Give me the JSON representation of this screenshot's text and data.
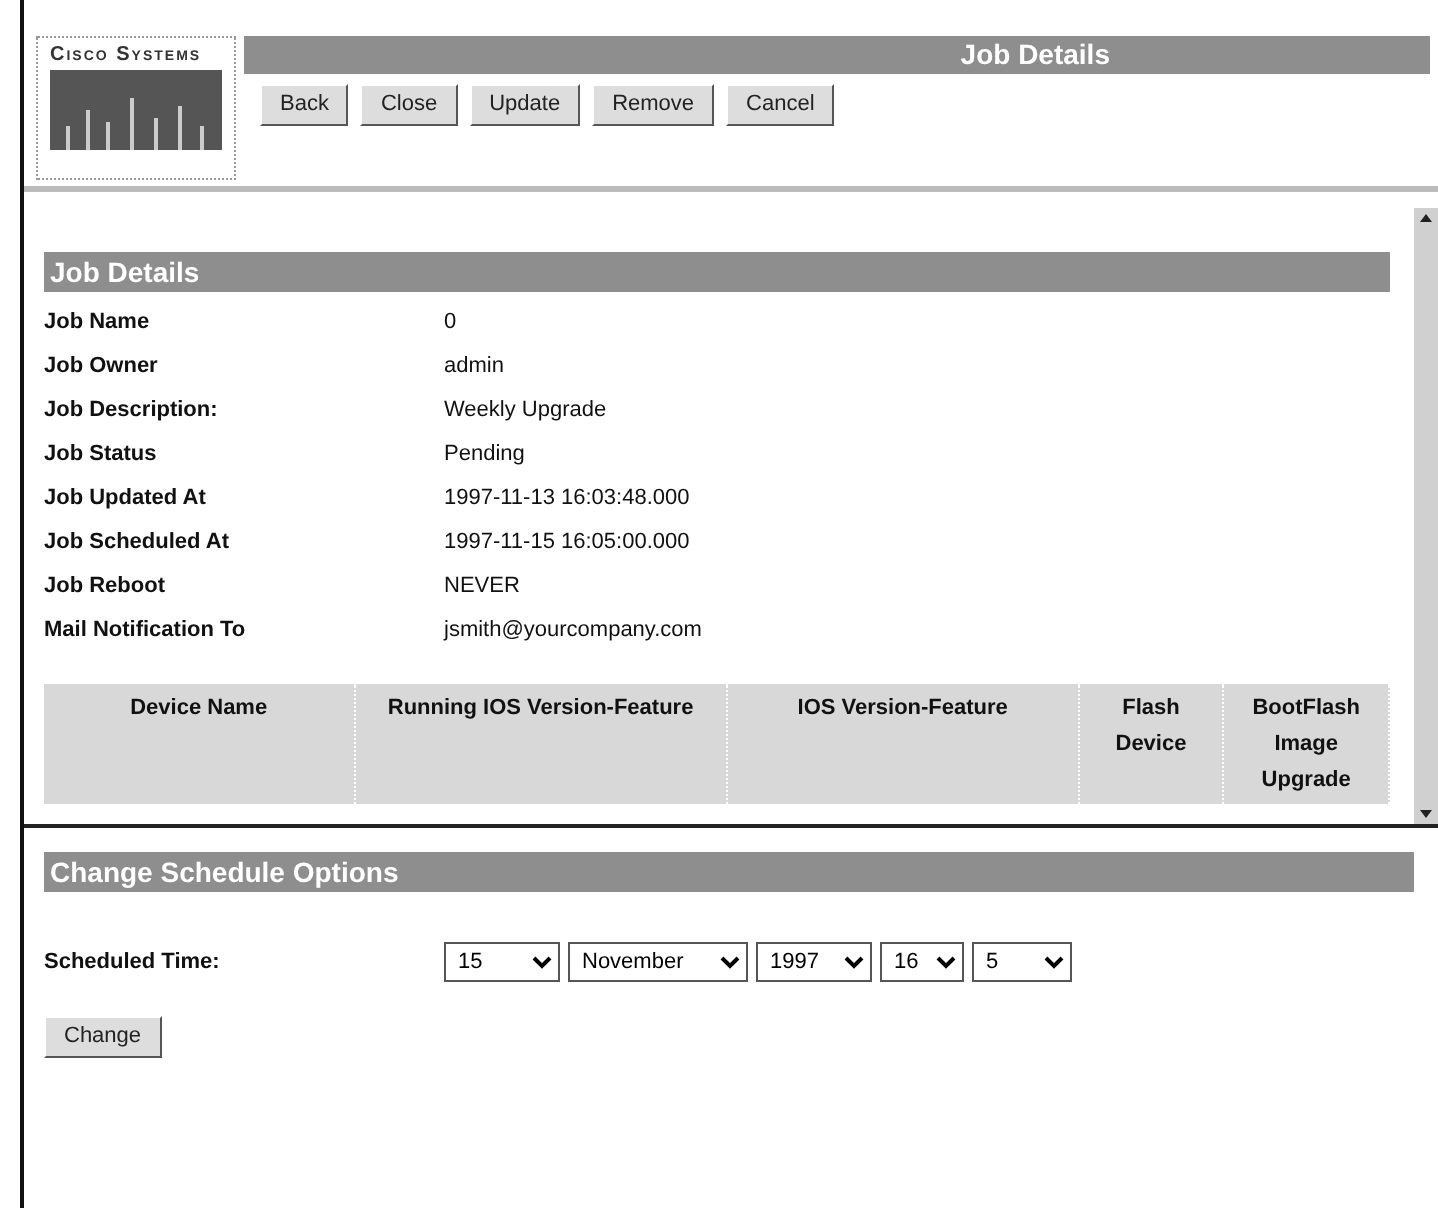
{
  "logo": {
    "text": "Cisco Systems"
  },
  "header": {
    "title": "Job Details"
  },
  "toolbar": [
    "Back",
    "Close",
    "Update",
    "Remove",
    "Cancel"
  ],
  "details": {
    "title": "Job Details",
    "fields": [
      {
        "label": "Job Name",
        "value": "0"
      },
      {
        "label": "Job Owner",
        "value": "admin"
      },
      {
        "label": "Job Description:",
        "value": "Weekly Upgrade"
      },
      {
        "label": "Job Status",
        "value": "Pending"
      },
      {
        "label": "Job Updated At",
        "value": "1997-11-13 16:03:48.000"
      },
      {
        "label": "Job Scheduled At",
        "value": "1997-11-15 16:05:00.000"
      },
      {
        "label": "Job Reboot",
        "value": "NEVER"
      },
      {
        "label": "Mail Notification To",
        "value": "jsmith@yourcompany.com"
      }
    ]
  },
  "table": {
    "columns": [
      "Device Name",
      "Running IOS Version-Feature",
      "IOS Version-Feature",
      "Flash Device",
      "BootFlash Image Upgrade"
    ]
  },
  "schedule": {
    "title": "Change Schedule Options",
    "label": "Scheduled Time:",
    "selects": [
      "15",
      "November",
      "1997",
      "16",
      "5"
    ],
    "button": "Change"
  }
}
